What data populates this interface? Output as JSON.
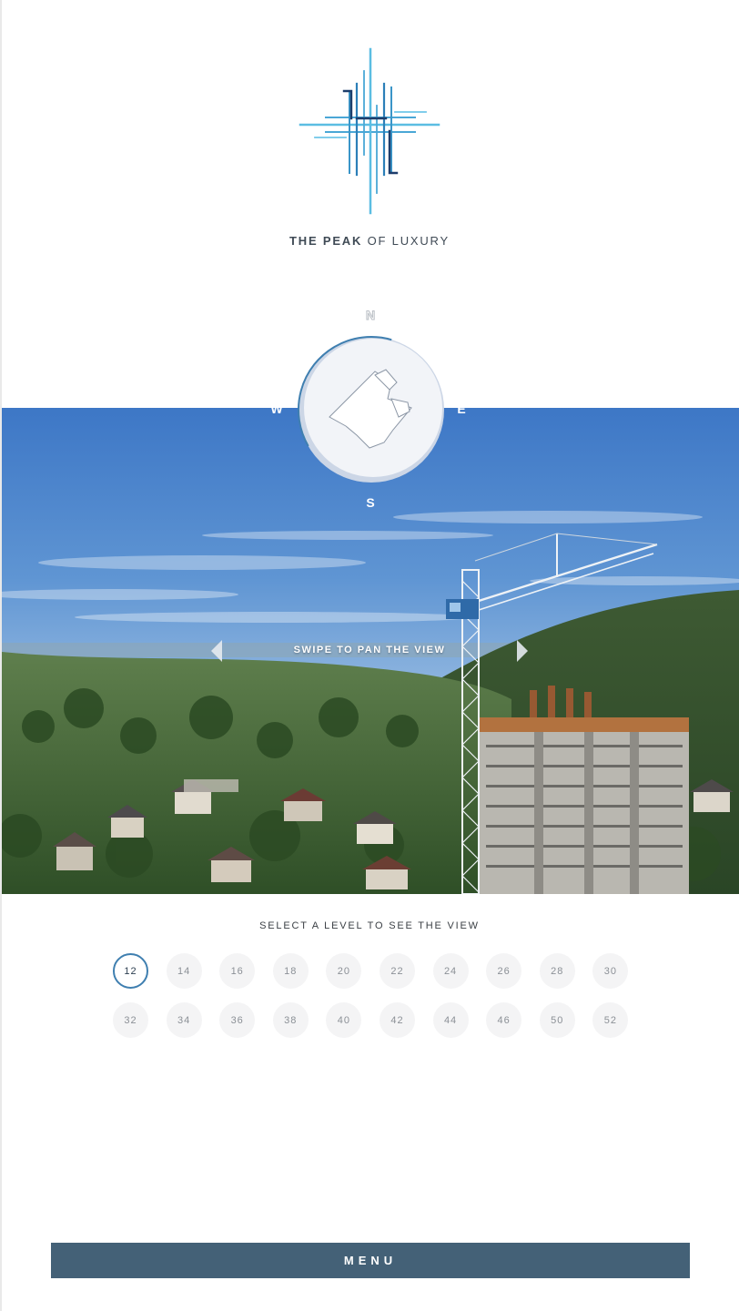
{
  "brand": {
    "tagline_strong": "THE PEAK",
    "tagline_rest": "OF LUXURY",
    "colors": {
      "light_blue": "#5bbde2",
      "mid_blue": "#2c7fb8",
      "dark_blue": "#1d3d6b"
    }
  },
  "compass": {
    "north": "N",
    "south": "S",
    "east": "E",
    "west": "W"
  },
  "view": {
    "pan_hint": "SWIPE TO PAN THE VIEW"
  },
  "levels": {
    "title": "SELECT A LEVEL TO SEE THE VIEW",
    "selected": "12",
    "items": [
      "12",
      "14",
      "16",
      "18",
      "20",
      "22",
      "24",
      "26",
      "28",
      "30",
      "32",
      "34",
      "36",
      "38",
      "40",
      "42",
      "44",
      "46",
      "50",
      "52"
    ]
  },
  "menu": {
    "label": "MENU"
  }
}
